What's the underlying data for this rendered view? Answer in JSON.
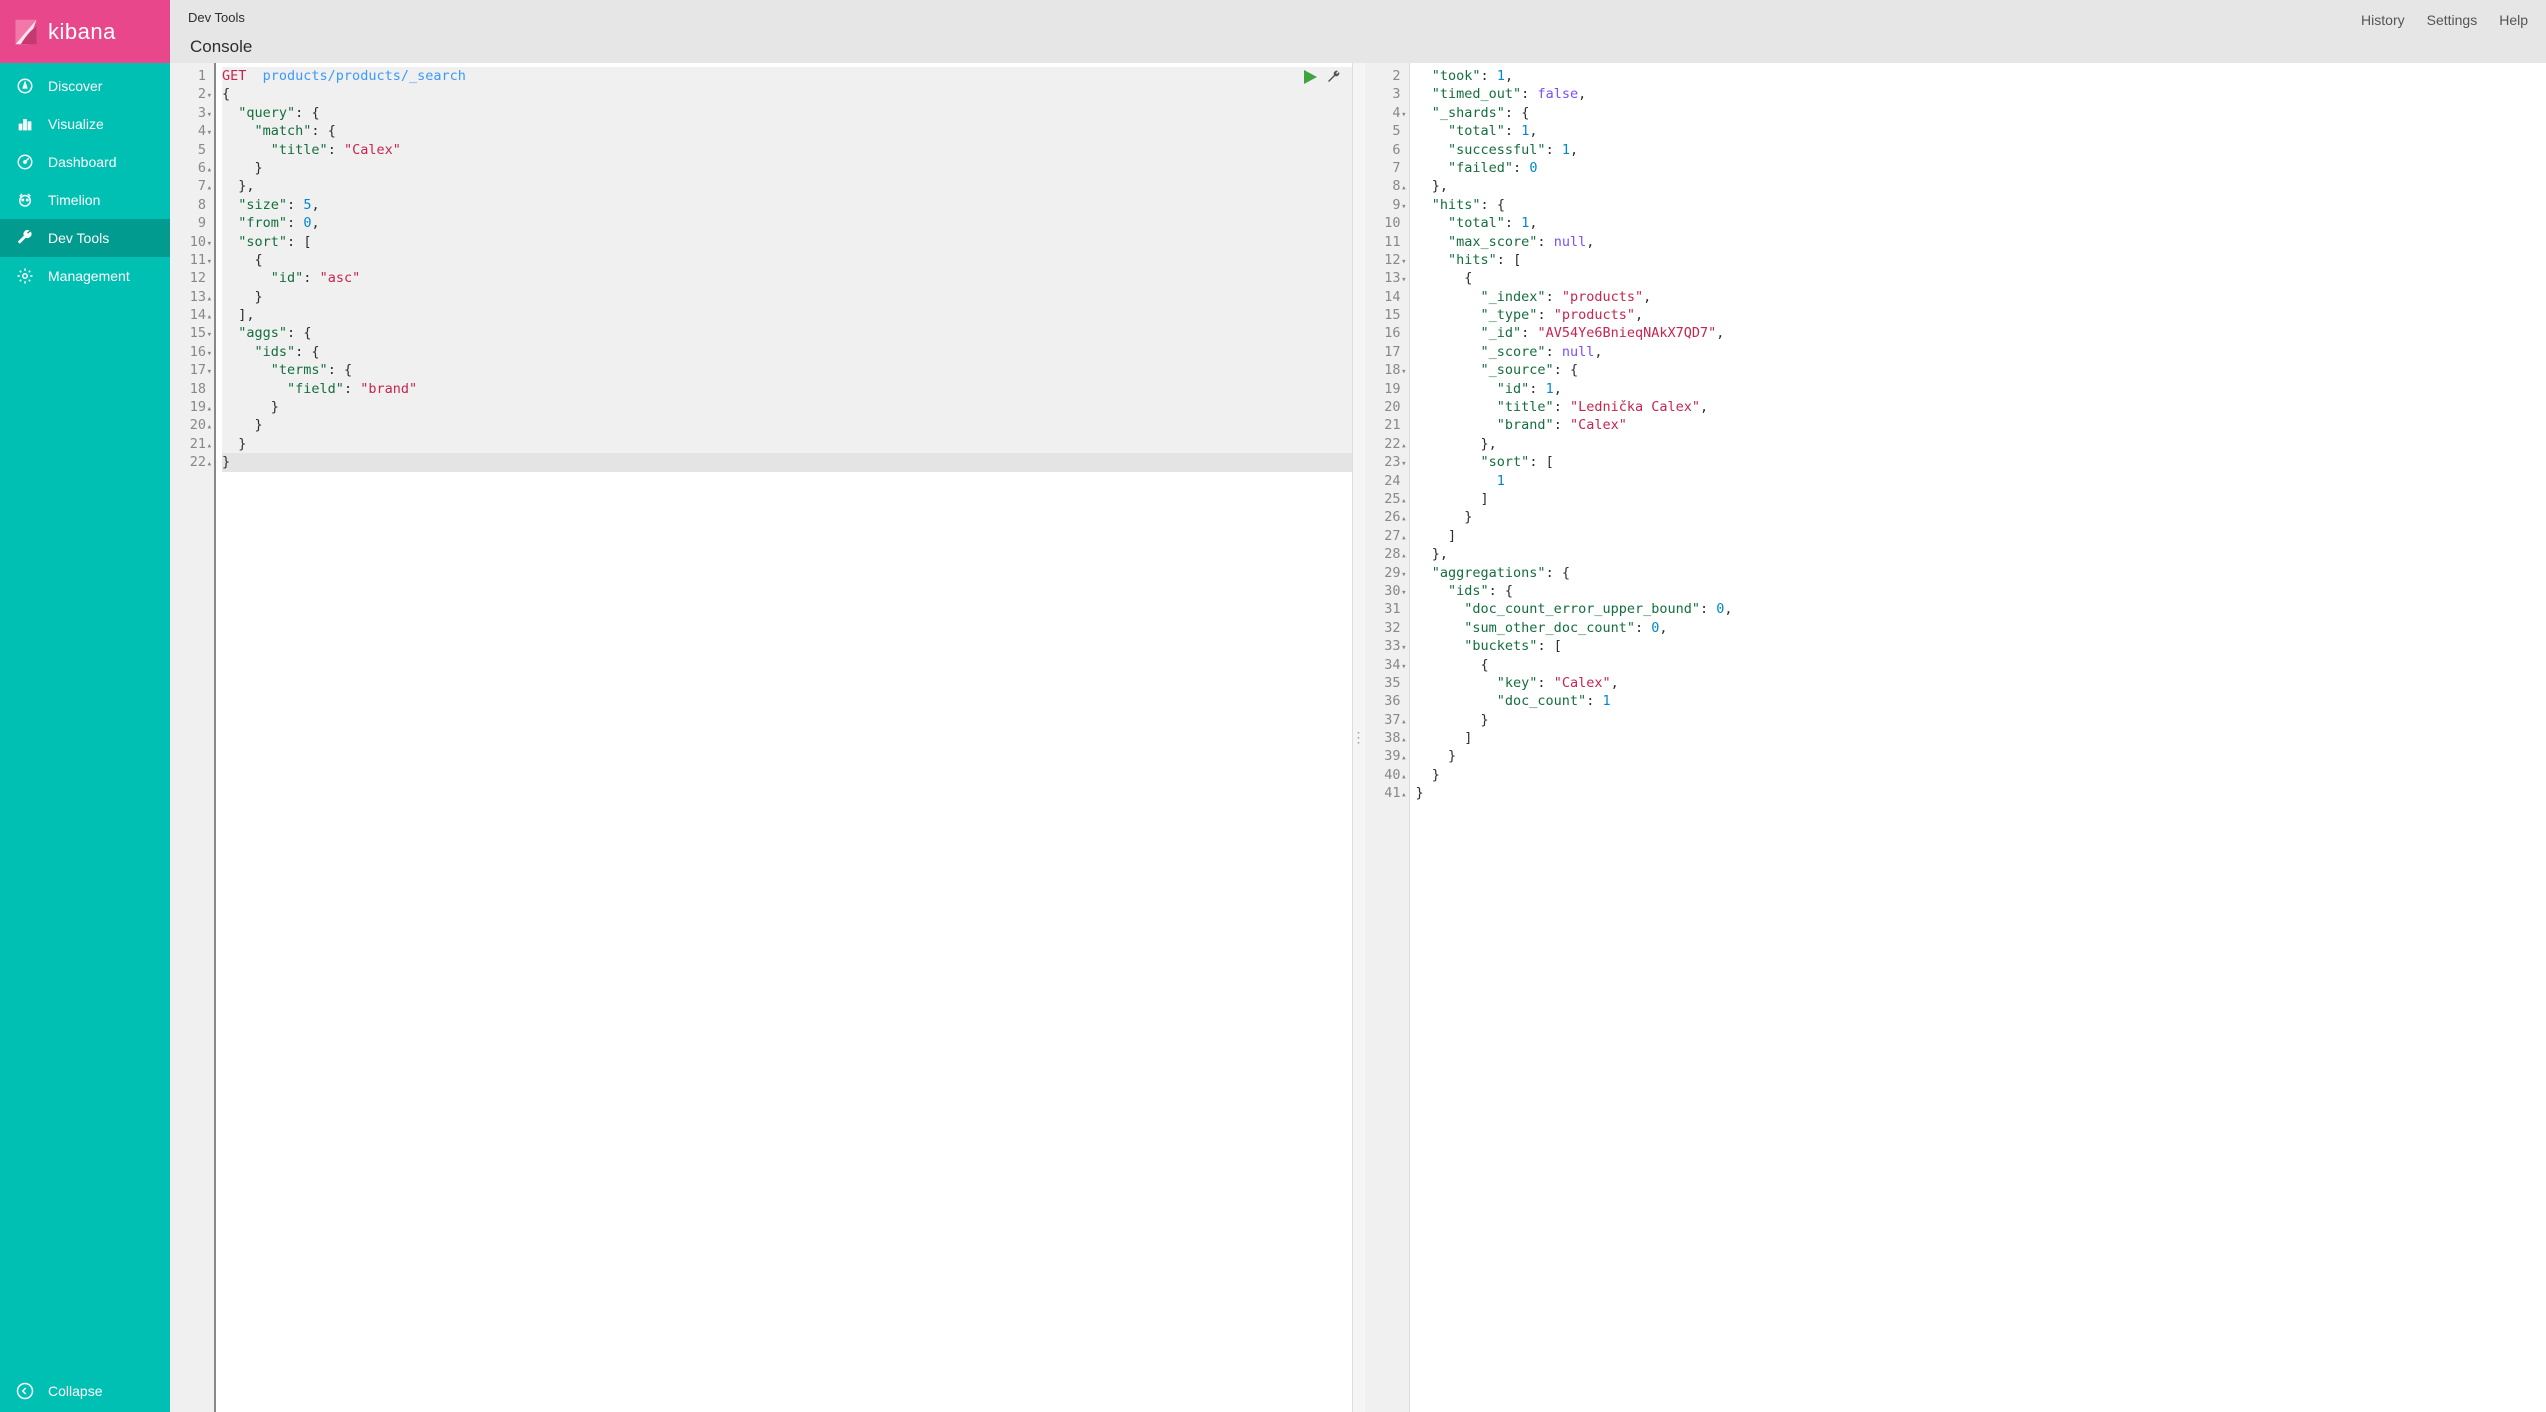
{
  "brand": "kibana",
  "sidebar": {
    "items": [
      {
        "label": "Discover",
        "icon": "compass"
      },
      {
        "label": "Visualize",
        "icon": "chart"
      },
      {
        "label": "Dashboard",
        "icon": "gauge"
      },
      {
        "label": "Timelion",
        "icon": "timelion"
      },
      {
        "label": "Dev Tools",
        "icon": "wrench"
      },
      {
        "label": "Management",
        "icon": "gear"
      }
    ],
    "collapse": "Collapse"
  },
  "header": {
    "breadcrumb": "Dev Tools",
    "tab": "Console",
    "links": [
      "History",
      "Settings",
      "Help"
    ]
  },
  "request": {
    "method": "GET",
    "path": "products/products/_search",
    "body": {
      "query": {
        "match": {
          "title": "Calex"
        }
      },
      "size": 5,
      "from": 0,
      "sort": [
        {
          "id": "asc"
        }
      ],
      "aggs": {
        "ids": {
          "terms": {
            "field": "brand"
          }
        }
      }
    }
  },
  "request_lines": [
    {
      "n": 1,
      "fold": "",
      "html": "<span class='tok-method'>GET</span>  <span class='tok-path'>products/products/_search</span>"
    },
    {
      "n": 2,
      "fold": "▾",
      "html": "<span class='tok-punc'>{</span>"
    },
    {
      "n": 3,
      "fold": "▾",
      "html": "  <span class='tok-key'>\"query\"</span>: <span class='tok-punc'>{</span>"
    },
    {
      "n": 4,
      "fold": "▾",
      "html": "    <span class='tok-key'>\"match\"</span>: <span class='tok-punc'>{</span>"
    },
    {
      "n": 5,
      "fold": "",
      "html": "      <span class='tok-key'>\"title\"</span>: <span class='tok-str'>\"Calex\"</span>"
    },
    {
      "n": 6,
      "fold": "▴",
      "html": "    <span class='tok-punc'>}</span>"
    },
    {
      "n": 7,
      "fold": "▴",
      "html": "  <span class='tok-punc'>},</span>"
    },
    {
      "n": 8,
      "fold": "",
      "html": "  <span class='tok-key'>\"size\"</span>: <span class='tok-num'>5</span><span class='tok-punc'>,</span>"
    },
    {
      "n": 9,
      "fold": "",
      "html": "  <span class='tok-key'>\"from\"</span>: <span class='tok-num'>0</span><span class='tok-punc'>,</span>"
    },
    {
      "n": 10,
      "fold": "▾",
      "html": "  <span class='tok-key'>\"sort\"</span>: <span class='tok-punc'>[</span>"
    },
    {
      "n": 11,
      "fold": "▾",
      "html": "    <span class='tok-punc'>{</span>"
    },
    {
      "n": 12,
      "fold": "",
      "html": "      <span class='tok-key'>\"id\"</span>: <span class='tok-str'>\"asc\"</span>"
    },
    {
      "n": 13,
      "fold": "▴",
      "html": "    <span class='tok-punc'>}</span>"
    },
    {
      "n": 14,
      "fold": "▴",
      "html": "  <span class='tok-punc'>],</span>"
    },
    {
      "n": 15,
      "fold": "▾",
      "html": "  <span class='tok-key'>\"aggs\"</span>: <span class='tok-punc'>{</span>"
    },
    {
      "n": 16,
      "fold": "▾",
      "html": "    <span class='tok-key'>\"ids\"</span>: <span class='tok-punc'>{</span>"
    },
    {
      "n": 17,
      "fold": "▾",
      "html": "      <span class='tok-key'>\"terms\"</span>: <span class='tok-punc'>{</span>"
    },
    {
      "n": 18,
      "fold": "",
      "html": "        <span class='tok-key'>\"field\"</span>: <span class='tok-str'>\"brand\"</span>"
    },
    {
      "n": 19,
      "fold": "▴",
      "html": "      <span class='tok-punc'>}</span>"
    },
    {
      "n": 20,
      "fold": "▴",
      "html": "    <span class='tok-punc'>}</span>"
    },
    {
      "n": 21,
      "fold": "▴",
      "html": "  <span class='tok-punc'>}</span>"
    },
    {
      "n": 22,
      "fold": "▴",
      "html": "<span class='tok-punc'>}</span>"
    }
  ],
  "response": {
    "took": 1,
    "timed_out": false,
    "_shards": {
      "total": 1,
      "successful": 1,
      "failed": 0
    },
    "hits": {
      "total": 1,
      "max_score": null,
      "hits": [
        {
          "_index": "products",
          "_type": "products",
          "_id": "AV54Ye6BnieqNAkX7QD7",
          "_score": null,
          "_source": {
            "id": 1,
            "title": "Lednička Calex",
            "brand": "Calex"
          },
          "sort": [
            1
          ]
        }
      ]
    },
    "aggregations": {
      "ids": {
        "doc_count_error_upper_bound": 0,
        "sum_other_doc_count": 0,
        "buckets": [
          {
            "key": "Calex",
            "doc_count": 1
          }
        ]
      }
    }
  },
  "response_lines": [
    {
      "n": 2,
      "fold": "",
      "html": "  <span class='tok-key'>\"took\"</span>: <span class='tok-num'>1</span><span class='tok-punc'>,</span>"
    },
    {
      "n": 3,
      "fold": "",
      "html": "  <span class='tok-key'>\"timed_out\"</span>: <span class='tok-kw'>false</span><span class='tok-punc'>,</span>"
    },
    {
      "n": 4,
      "fold": "▾",
      "html": "  <span class='tok-key'>\"_shards\"</span>: <span class='tok-punc'>{</span>"
    },
    {
      "n": 5,
      "fold": "",
      "html": "    <span class='tok-key'>\"total\"</span>: <span class='tok-num'>1</span><span class='tok-punc'>,</span>"
    },
    {
      "n": 6,
      "fold": "",
      "html": "    <span class='tok-key'>\"successful\"</span>: <span class='tok-num'>1</span><span class='tok-punc'>,</span>"
    },
    {
      "n": 7,
      "fold": "",
      "html": "    <span class='tok-key'>\"failed\"</span>: <span class='tok-num'>0</span>"
    },
    {
      "n": 8,
      "fold": "▴",
      "html": "  <span class='tok-punc'>},</span>"
    },
    {
      "n": 9,
      "fold": "▾",
      "html": "  <span class='tok-key'>\"hits\"</span>: <span class='tok-punc'>{</span>"
    },
    {
      "n": 10,
      "fold": "",
      "html": "    <span class='tok-key'>\"total\"</span>: <span class='tok-num'>1</span><span class='tok-punc'>,</span>"
    },
    {
      "n": 11,
      "fold": "",
      "html": "    <span class='tok-key'>\"max_score\"</span>: <span class='tok-kw'>null</span><span class='tok-punc'>,</span>"
    },
    {
      "n": 12,
      "fold": "▾",
      "html": "    <span class='tok-key'>\"hits\"</span>: <span class='tok-punc'>[</span>"
    },
    {
      "n": 13,
      "fold": "▾",
      "html": "      <span class='tok-punc'>{</span>"
    },
    {
      "n": 14,
      "fold": "",
      "html": "        <span class='tok-key'>\"_index\"</span>: <span class='tok-str'>\"products\"</span><span class='tok-punc'>,</span>"
    },
    {
      "n": 15,
      "fold": "",
      "html": "        <span class='tok-key'>\"_type\"</span>: <span class='tok-str'>\"products\"</span><span class='tok-punc'>,</span>"
    },
    {
      "n": 16,
      "fold": "",
      "html": "        <span class='tok-key'>\"_id\"</span>: <span class='tok-str'>\"AV54Ye6BnieqNAkX7QD7\"</span><span class='tok-punc'>,</span>"
    },
    {
      "n": 17,
      "fold": "",
      "html": "        <span class='tok-key'>\"_score\"</span>: <span class='tok-kw'>null</span><span class='tok-punc'>,</span>"
    },
    {
      "n": 18,
      "fold": "▾",
      "html": "        <span class='tok-key'>\"_source\"</span>: <span class='tok-punc'>{</span>"
    },
    {
      "n": 19,
      "fold": "",
      "html": "          <span class='tok-key'>\"id\"</span>: <span class='tok-num'>1</span><span class='tok-punc'>,</span>"
    },
    {
      "n": 20,
      "fold": "",
      "html": "          <span class='tok-key'>\"title\"</span>: <span class='tok-str'>\"Lednička Calex\"</span><span class='tok-punc'>,</span>"
    },
    {
      "n": 21,
      "fold": "",
      "html": "          <span class='tok-key'>\"brand\"</span>: <span class='tok-str'>\"Calex\"</span>"
    },
    {
      "n": 22,
      "fold": "▴",
      "html": "        <span class='tok-punc'>},</span>"
    },
    {
      "n": 23,
      "fold": "▾",
      "html": "        <span class='tok-key'>\"sort\"</span>: <span class='tok-punc'>[</span>"
    },
    {
      "n": 24,
      "fold": "",
      "html": "          <span class='tok-num'>1</span>"
    },
    {
      "n": 25,
      "fold": "▴",
      "html": "        <span class='tok-punc'>]</span>"
    },
    {
      "n": 26,
      "fold": "▴",
      "html": "      <span class='tok-punc'>}</span>"
    },
    {
      "n": 27,
      "fold": "▴",
      "html": "    <span class='tok-punc'>]</span>"
    },
    {
      "n": 28,
      "fold": "▴",
      "html": "  <span class='tok-punc'>},</span>"
    },
    {
      "n": 29,
      "fold": "▾",
      "html": "  <span class='tok-key'>\"aggregations\"</span>: <span class='tok-punc'>{</span>"
    },
    {
      "n": 30,
      "fold": "▾",
      "html": "    <span class='tok-key'>\"ids\"</span>: <span class='tok-punc'>{</span>"
    },
    {
      "n": 31,
      "fold": "",
      "html": "      <span class='tok-key'>\"doc_count_error_upper_bound\"</span>: <span class='tok-num'>0</span><span class='tok-punc'>,</span>"
    },
    {
      "n": 32,
      "fold": "",
      "html": "      <span class='tok-key'>\"sum_other_doc_count\"</span>: <span class='tok-num'>0</span><span class='tok-punc'>,</span>"
    },
    {
      "n": 33,
      "fold": "▾",
      "html": "      <span class='tok-key'>\"buckets\"</span>: <span class='tok-punc'>[</span>"
    },
    {
      "n": 34,
      "fold": "▾",
      "html": "        <span class='tok-punc'>{</span>"
    },
    {
      "n": 35,
      "fold": "",
      "html": "          <span class='tok-key'>\"key\"</span>: <span class='tok-str'>\"Calex\"</span><span class='tok-punc'>,</span>"
    },
    {
      "n": 36,
      "fold": "",
      "html": "          <span class='tok-key'>\"doc_count\"</span>: <span class='tok-num'>1</span>"
    },
    {
      "n": 37,
      "fold": "▴",
      "html": "        <span class='tok-punc'>}</span>"
    },
    {
      "n": 38,
      "fold": "▴",
      "html": "      <span class='tok-punc'>]</span>"
    },
    {
      "n": 39,
      "fold": "▴",
      "html": "    <span class='tok-punc'>}</span>"
    },
    {
      "n": 40,
      "fold": "▴",
      "html": "  <span class='tok-punc'>}</span>"
    },
    {
      "n": 41,
      "fold": "▴",
      "html": "<span class='tok-punc'>}</span>"
    }
  ]
}
